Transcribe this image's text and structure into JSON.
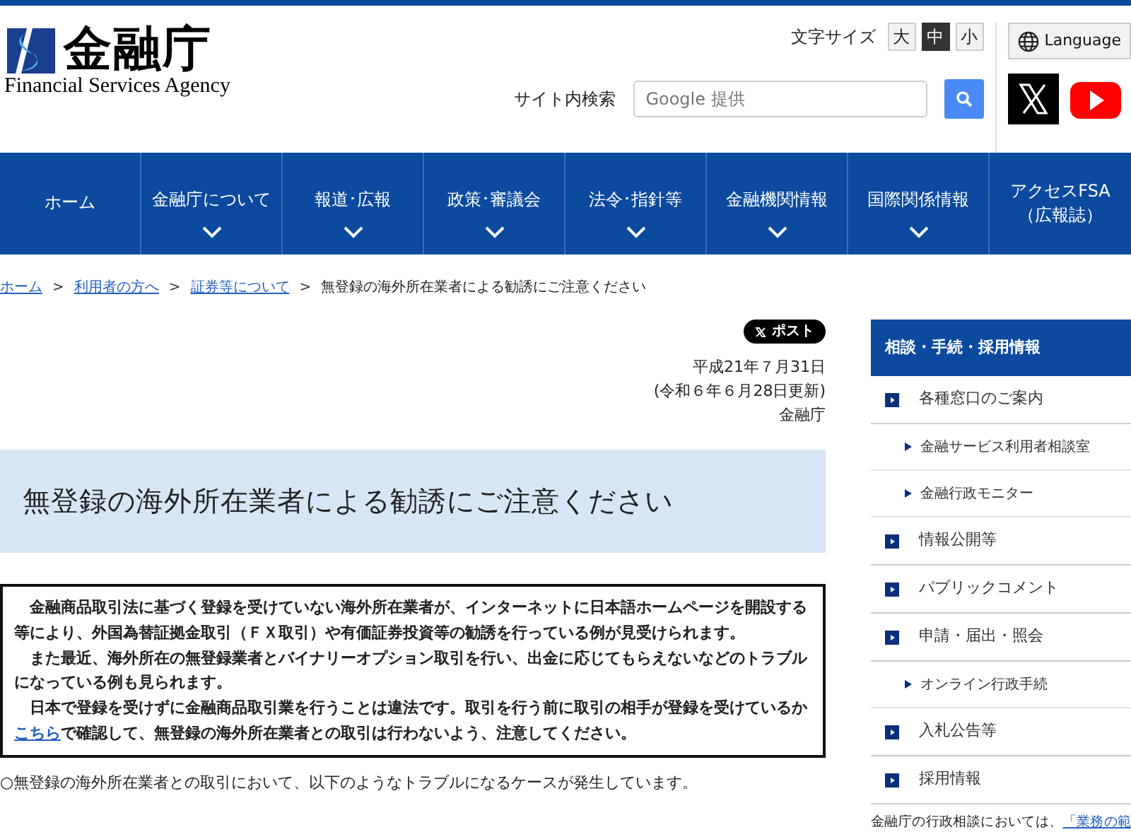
{
  "header": {
    "logo": {
      "name_ja": "金融庁",
      "name_en": "Financial Services Agency"
    },
    "font_size": {
      "label": "文字サイズ",
      "options": [
        {
          "label": "大",
          "selected": false
        },
        {
          "label": "中",
          "selected": true
        },
        {
          "label": "小",
          "selected": false
        }
      ]
    },
    "language_button": "Language",
    "search": {
      "label": "サイト内検索",
      "placeholder": "Google 提供"
    }
  },
  "nav": [
    {
      "label": "ホーム",
      "has_dropdown": false
    },
    {
      "label": "金融庁について",
      "has_dropdown": true
    },
    {
      "label": "報道･広報",
      "has_dropdown": true
    },
    {
      "label": "政策･審議会",
      "has_dropdown": true
    },
    {
      "label": "法令･指針等",
      "has_dropdown": true
    },
    {
      "label": "金融機関情報",
      "has_dropdown": true
    },
    {
      "label": "国際関係情報",
      "has_dropdown": true
    },
    {
      "label": "アクセスFSA（広報誌）",
      "has_dropdown": false
    }
  ],
  "breadcrumb_separator": ">",
  "breadcrumb": [
    {
      "label": "ホーム",
      "link": true
    },
    {
      "label": "利用者の方へ",
      "link": true
    },
    {
      "label": "証券等について",
      "link": true
    },
    {
      "label": "無登録の海外所在業者による勧誘にご注意ください",
      "link": false
    }
  ],
  "post_button": "ポスト",
  "dates": [
    "平成21年７月31日",
    "(令和６年６月28日更新)",
    "金融庁"
  ],
  "title": "無登録の海外所在業者による勧誘にご注意ください",
  "notice": [
    [
      {
        "kind": "text",
        "text": "金融商品取引法に基づく登録を受けていない海外所在業者が、インターネットに日本語ホームページを開設する等により、外国為替証拠金取引（ＦＸ取引）や有価証券投資等の勧誘を行っている例が見受けられます。"
      }
    ],
    [
      {
        "kind": "text",
        "text": "また最近、海外所在の無登録業者とバイナリーオプション取引を行い、出金に応じてもらえないなどのトラブルになっている例も見られます。"
      }
    ],
    [
      {
        "kind": "text",
        "text": "日本で登録を受けずに金融商品取引業を行うことは違法です。取引を行う前に取引の相手が登録を受けているか"
      },
      {
        "kind": "link",
        "text": "こちら"
      },
      {
        "kind": "text",
        "text": "で確認して、無登録の海外所在業者との取引は行わないよう、注意してください。"
      }
    ]
  ],
  "intro": "○無登録の海外所在業者との取引において、以下のようなトラブルになるケースが発生しています。",
  "sidebar": {
    "heading": "相談・手続・採用情報",
    "items": [
      {
        "label": "各種窓口のご案内",
        "children": [
          {
            "label": "金融サービス利用者相談室"
          },
          {
            "label": "金融行政モニター"
          }
        ]
      },
      {
        "label": "情報公開等"
      },
      {
        "label": "パブリックコメント"
      },
      {
        "label": "申請・届出・照会",
        "children": [
          {
            "label": "オンライン行政手続"
          }
        ]
      },
      {
        "label": "入札公告等"
      },
      {
        "label": "採用情報"
      }
    ],
    "footer": [
      {
        "kind": "text",
        "text": "金融庁の行政相談においては、"
      },
      {
        "kind": "link",
        "text": "「業務の範"
      }
    ]
  }
}
